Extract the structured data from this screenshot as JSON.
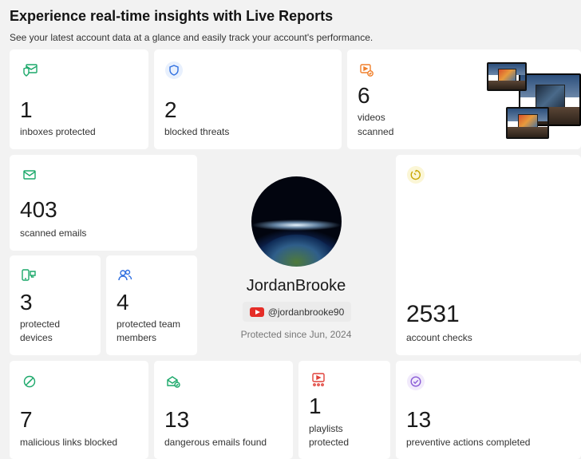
{
  "header": {
    "title": "Experience real-time insights with Live Reports",
    "subtitle": "See your latest account data at a glance and easily track your account's performance."
  },
  "stats": {
    "inboxes": {
      "value": "1",
      "label": "inboxes protected",
      "icon": "inbox-shield-icon"
    },
    "threats": {
      "value": "2",
      "label": "blocked threats",
      "icon": "shield-icon"
    },
    "videos": {
      "value": "6",
      "label_1": "videos",
      "label_2": "scanned",
      "icon": "video-scan-icon"
    },
    "emails": {
      "value": "403",
      "label": "scanned emails",
      "icon": "envelope-icon"
    },
    "account_checks": {
      "value": "2531",
      "label": "account checks",
      "icon": "timer-icon"
    },
    "devices": {
      "value": "3",
      "label_1": "protected",
      "label_2": "devices",
      "icon": "devices-icon"
    },
    "team": {
      "value": "4",
      "label_1": "protected team",
      "label_2": "members",
      "icon": "team-icon"
    },
    "links": {
      "value": "7",
      "label": "malicious links blocked",
      "icon": "blocked-link-icon"
    },
    "dangerous": {
      "value": "13",
      "label": "dangerous emails found",
      "icon": "mail-check-icon"
    },
    "playlists": {
      "value": "1",
      "label_1": "playlists",
      "label_2": "protected",
      "icon": "playlist-icon"
    },
    "preventive": {
      "value": "13",
      "label": "preventive actions completed",
      "icon": "check-circle-icon"
    }
  },
  "profile": {
    "name": "JordanBrooke",
    "handle": "@jordanbrooke90",
    "since": "Protected since Jun, 2024",
    "platform_icon": "youtube-icon"
  },
  "colors": {
    "green": "#1ba86a",
    "blue": "#2f6fe0",
    "orange": "#f07f2a",
    "red": "#e0413a",
    "yellow": "#d6b300",
    "purple": "#8a5cd6"
  }
}
